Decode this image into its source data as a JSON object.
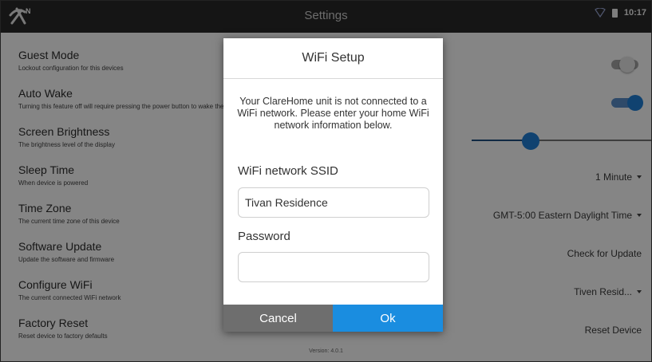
{
  "statusbar": {
    "time": "10:17",
    "wifi_icon": "wifi-outline-icon",
    "battery_icon": "battery-icon"
  },
  "header": {
    "title": "Settings",
    "logo_icon": "clarehome-logo-icon"
  },
  "settings": {
    "guest_mode": {
      "title": "Guest Mode",
      "desc": "Lockout configuration for this devices",
      "toggle": "off"
    },
    "auto_wake": {
      "title": "Auto Wake",
      "desc": "Turning this feature off will require pressing the power button to wake the device",
      "toggle": "on"
    },
    "brightness": {
      "title": "Screen Brightness",
      "desc": "The brightness level of the display",
      "level": 0.33
    },
    "sleep_time": {
      "title": "Sleep Time",
      "desc": "When device is powered",
      "value": "1 Minute"
    },
    "time_zone": {
      "title": "Time Zone",
      "desc": "The current time zone of this device",
      "value": "GMT-5:00 Eastern Daylight Time"
    },
    "software_update": {
      "title": "Software Update",
      "desc": "Update the software and firmware",
      "action": "Check for Update"
    },
    "configure_wifi": {
      "title": "Configure WiFi",
      "desc": "The current connected WiFi network",
      "value": "Tiven Resid..."
    },
    "factory_reset": {
      "title": "Factory Reset",
      "desc": "Reset device to factory defaults",
      "action": "Reset Device"
    }
  },
  "footer": {
    "hint": "Version: 4.0.1"
  },
  "dialog": {
    "title": "WiFi Setup",
    "message": "Your ClareHome unit is not connected to a WiFi network. Please enter your home WiFi network information below.",
    "ssid_label": "WiFi network SSID",
    "ssid_value": "Tivan Residence",
    "password_label": "Password",
    "password_value": "",
    "cancel_label": "Cancel",
    "ok_label": "Ok"
  },
  "colors": {
    "accent": "#1a8de0",
    "cancel": "#6e6e6e",
    "topbar": "#2a2a2a"
  }
}
